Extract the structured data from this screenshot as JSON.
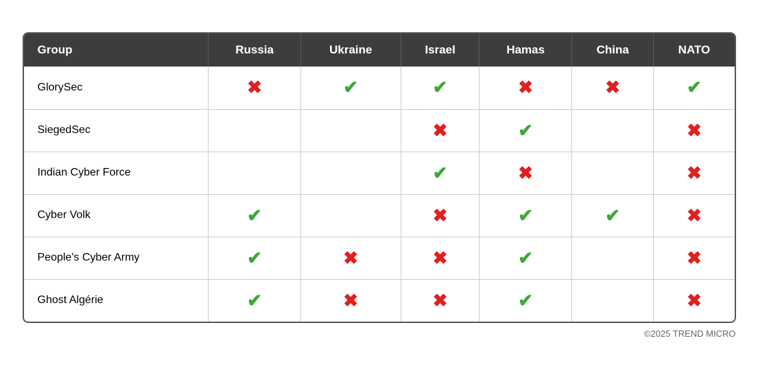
{
  "header": {
    "columns": [
      "Group",
      "Russia",
      "Ukraine",
      "Israel",
      "Hamas",
      "China",
      "NATO"
    ]
  },
  "rows": [
    {
      "group": "GlorySec",
      "russia": "cross",
      "ukraine": "check",
      "israel": "check",
      "hamas": "cross",
      "china": "cross",
      "nato": "check"
    },
    {
      "group": "SiegedSec",
      "russia": "",
      "ukraine": "",
      "israel": "cross",
      "hamas": "check",
      "china": "",
      "nato": "cross"
    },
    {
      "group": "Indian Cyber Force",
      "russia": "",
      "ukraine": "",
      "israel": "check",
      "hamas": "cross",
      "china": "",
      "nato": "cross"
    },
    {
      "group": "Cyber Volk",
      "russia": "check",
      "ukraine": "",
      "israel": "cross",
      "hamas": "check",
      "china": "check",
      "nato": "cross"
    },
    {
      "group": "People's Cyber Army",
      "russia": "check",
      "ukraine": "cross",
      "israel": "cross",
      "hamas": "check",
      "china": "",
      "nato": "cross"
    },
    {
      "group": "Ghost Algérie",
      "russia": "check",
      "ukraine": "cross",
      "israel": "cross",
      "hamas": "check",
      "china": "",
      "nato": "cross"
    }
  ],
  "copyright": "©2025 TREND MICRO",
  "symbols": {
    "check": "✔",
    "cross": "✖"
  }
}
